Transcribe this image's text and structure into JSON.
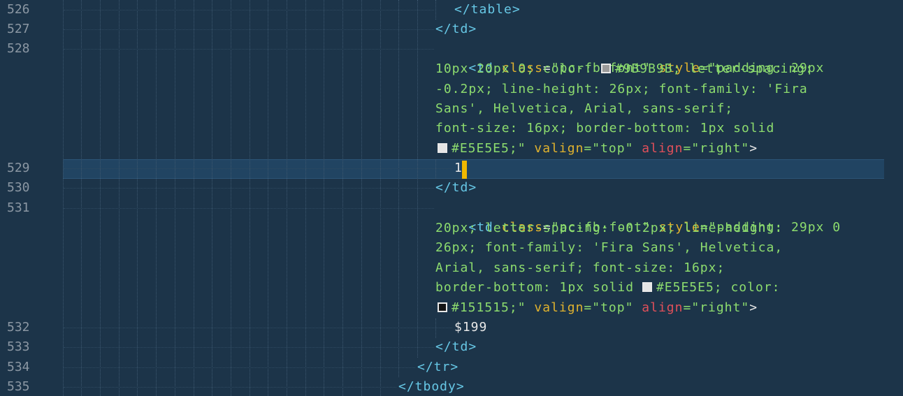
{
  "editor": {
    "line_numbers": [
      "526",
      "527",
      "528",
      "529",
      "530",
      "531",
      "532",
      "533",
      "534",
      "535"
    ],
    "current_line": "529",
    "lines": {
      "l526": {
        "tag": "</table>"
      },
      "l527": {
        "tag": "</td>"
      },
      "l528": {
        "r1_open": "<td",
        "r1_class_attr": "class",
        "r1_eq": "=",
        "r1_class_val": "\"pc-fb-font\"",
        "r1_style_attr": "style",
        "r1_style_start": "=\"padding: 29px",
        "r2_a": "10px 20px 0; color: ",
        "r2_b": "#9B9B9B; letter-spacing:",
        "r3": "-0.2px; line-height: 26px; font-family: 'Fira",
        "r4": "Sans', Helvetica, Arial, sans-serif;",
        "r5": "font-size: 16px; border-bottom: 1px solid",
        "r6_hex": "#E5E5E5;\"",
        "r6_valign_attr": "valign",
        "r6_valign_val": "=\"top\"",
        "r6_align_attr": "align",
        "r6_align_val": "=\"right\"",
        "r6_close": ">"
      },
      "l529": {
        "text": "1"
      },
      "l530": {
        "tag": "</td>"
      },
      "l531": {
        "r1_open": "<td",
        "r1_class_attr": "class",
        "r1_eq": "=",
        "r1_class_val": "\"pc-fb-font\"",
        "r1_style_attr": "style",
        "r1_style_start": "=\"padding: 29px 0",
        "r2": "20px; letter-spacing: -0.2px; line-height:",
        "r3": "26px; font-family: 'Fira Sans', Helvetica,",
        "r4": "Arial, sans-serif; font-size: 16px;",
        "r5_a": "border-bottom: 1px solid ",
        "r5_b": "#E5E5E5; color:",
        "r6_hex": "#151515;\"",
        "r6_valign_attr": "valign",
        "r6_valign_val": "=\"top\"",
        "r6_align_attr": "align",
        "r6_align_val": "=\"right\"",
        "r6_close": ">"
      },
      "l532": {
        "text": "$199"
      },
      "l533": {
        "tag": "</td>"
      },
      "l534": {
        "tag": "</tr>"
      },
      "l535": {
        "tag": "</tbody>"
      }
    },
    "swatches": {
      "c9B9B9B": "#9B9B9B",
      "cE5E5E5": "#E5E5E5",
      "c151515": "#151515"
    },
    "colors": {
      "background": "#1c3449",
      "current_line": "#214462",
      "tag": "#67c8e6",
      "attribute": "#e0b22e",
      "attribute_align": "#e0505a",
      "string": "#8ddc6e",
      "line_number": "#8b97a3",
      "caret": "#f0b800"
    }
  }
}
